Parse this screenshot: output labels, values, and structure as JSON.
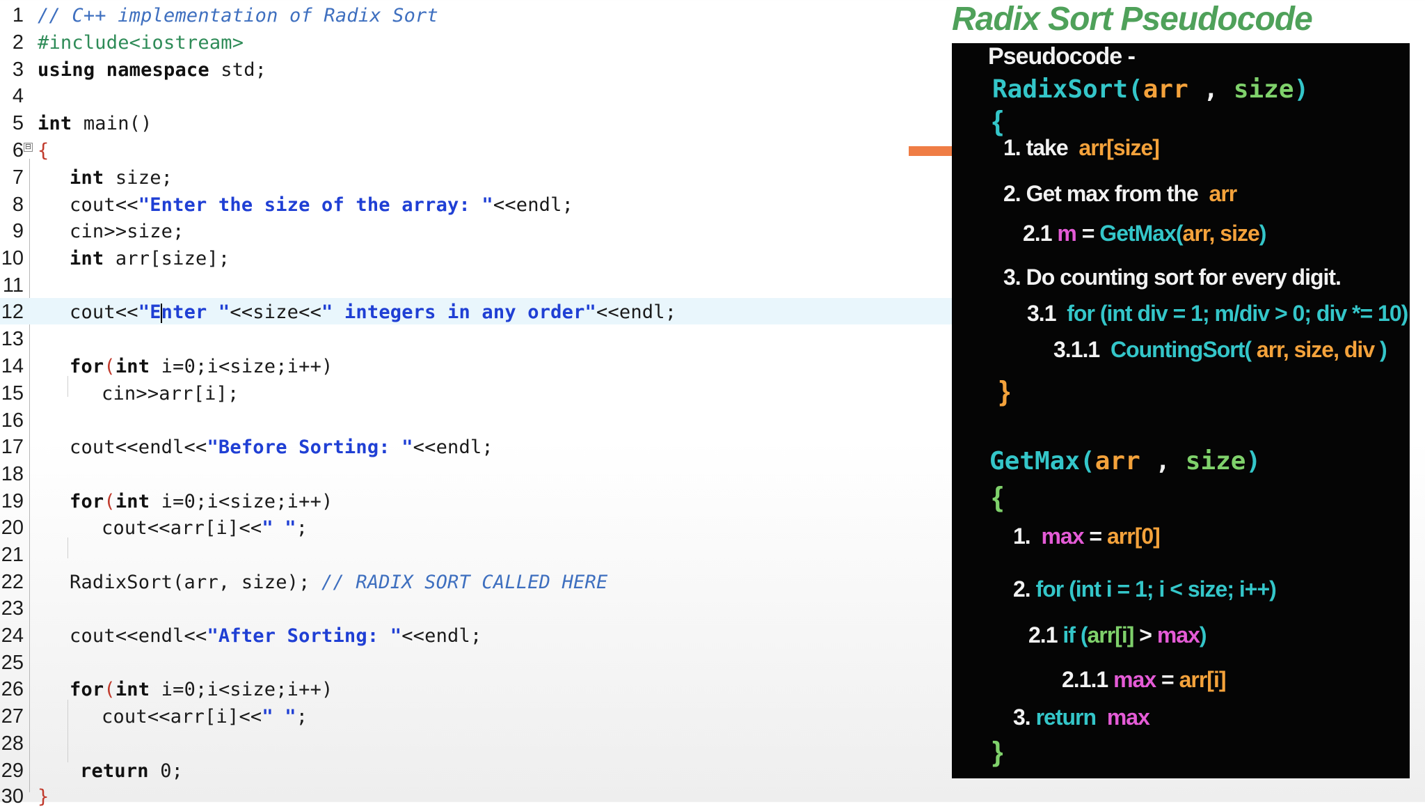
{
  "editor": {
    "line_numbers": [
      "1",
      "2",
      "3",
      "4",
      "5",
      "6",
      "7",
      "8",
      "9",
      "10",
      "11",
      "12",
      "13",
      "14",
      "15",
      "16",
      "17",
      "18",
      "19",
      "20",
      "21",
      "22",
      "23",
      "24",
      "25",
      "26",
      "27",
      "28",
      "29",
      "30"
    ],
    "fold_toggle": "⊟",
    "code": {
      "l1": "// C++ implementation of Radix Sort",
      "l2": "#include<iostream>",
      "l3_kw": "using namespace",
      "l3_rest": " std;",
      "l5_kw": "int",
      "l5_rest": " main()",
      "l6": "{",
      "l7_kw": "int",
      "l7_rest": " size;",
      "l8_a": "cout<<",
      "l8_str": "\"Enter the size of the array: \"",
      "l8_b": "<<endl;",
      "l9": "cin>>size;",
      "l10_kw": "int",
      "l10_rest": " arr[size];",
      "l12_a": "cout<<",
      "l12_str1a": "\"E",
      "l12_str1b": "nter \"",
      "l12_b": "<<size<<",
      "l12_str2": "\" integers in any order\"",
      "l12_c": "<<endl;",
      "l14_kw": "for",
      "l14_a": "(",
      "l14_kw2": "int",
      "l14_rest": " i=0;i<size;i++)",
      "l15": "cin>>arr[i];",
      "l17_a": "cout<<endl<<",
      "l17_str": "\"Before Sorting: \"",
      "l17_b": "<<endl;",
      "l19_kw": "for",
      "l19_a": "(",
      "l19_kw2": "int",
      "l19_rest": " i=0;i<size;i++)",
      "l20_a": "cout<<arr[i]<<",
      "l20_str": "\" \"",
      "l20_b": ";",
      "l22_a": "RadixSort(arr, size); ",
      "l22_cmt": "// RADIX SORT CALLED HERE",
      "l24_a": "cout<<endl<<",
      "l24_str": "\"After Sorting: \"",
      "l24_b": "<<endl;",
      "l26_kw": "for",
      "l26_a": "(",
      "l26_kw2": "int",
      "l26_rest": " i=0;i<size;i++)",
      "l27_a": "cout<<arr[i]<<",
      "l27_str": "\" \"",
      "l27_b": ";",
      "l29_kw": "return",
      "l29_rest": " 0;",
      "l30": "}"
    }
  },
  "panel": {
    "title": "Radix Sort Pseudocode",
    "header": "Pseudocode -",
    "radix_name": "RadixSort(",
    "radix_args": "arr",
    "radix_comma": " , ",
    "radix_size": "size",
    "radix_close": ")",
    "open1": "{",
    "s1_label": "1. take",
    "s1_val": "arr[size]",
    "s2_label": "2. Get max from the",
    "s2_val": "arr",
    "s21_label": "2.1",
    "s21_m": "m",
    "s21_eq": " = ",
    "s21_fn": "GetMax(",
    "s21_args": "arr, size",
    "s21_close": ")",
    "s3_label": "3. Do counting sort for every digit.",
    "s31_label": "3.1",
    "s31_code": "for (int div = 1; m/div > 0; div *= 10)",
    "s311_label": "3.1.1",
    "s311_fn": "CountingSort(",
    "s311_args": " arr, size, div ",
    "s311_close": ")",
    "close1": "}",
    "getmax_name": "GetMax(",
    "getmax_args": "arr",
    "getmax_comma": " , ",
    "getmax_size": "size",
    "getmax_close": ")",
    "open2": "{",
    "g1_label": "1.",
    "g1_max": "max",
    "g1_eq": " = ",
    "g1_val": "arr[0]",
    "g2_label": "2.",
    "g2_code": "for (int i = 1; i < size; i++)",
    "g21_label": "2.1",
    "g21_if": "if (",
    "g21_arr": "arr[i]",
    "g21_gt": " > ",
    "g21_max": "max",
    "g21_close": ")",
    "g211_label": "2.1.1",
    "g211_max": "max",
    "g211_eq": " = ",
    "g211_val": "arr[i]",
    "g3_label": "3.",
    "g3_ret": "return",
    "g3_max": "max",
    "close2": "}"
  },
  "colors": {
    "keyword": "#111111",
    "string": "#1f3fd4",
    "operator": "#c0392b",
    "comment": "#3e6fbf",
    "preprocessor": "#2e8b57",
    "current_line": "#e9f6fc",
    "panel_bg": "#050505",
    "panel_title": "#4fa15a",
    "pseudo_teal": "#34c6c9",
    "pseudo_orange": "#f4a23b",
    "pseudo_green": "#7fd16b",
    "pseudo_magenta": "#e45bd6",
    "arrow": "#ef7d45"
  },
  "icons": {
    "arrow": "arrow-right-icon",
    "fold": "fold-toggle-icon"
  }
}
